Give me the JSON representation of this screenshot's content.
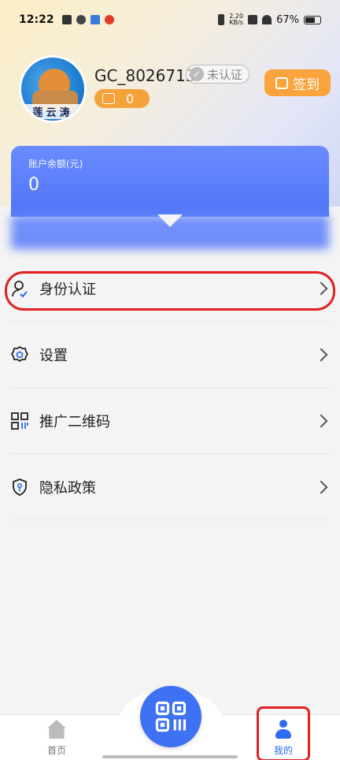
{
  "status_bar": {
    "time": "12:22",
    "net_speed": "2.20\nKB/s",
    "battery_percent": "67%"
  },
  "profile": {
    "username": "GC_8026713",
    "verify_status": "未认证",
    "coin_count": "0",
    "checkin_label": "签到",
    "avatar_text": "莲云涛"
  },
  "balance": {
    "label": "账户余额(元)",
    "value": "0"
  },
  "menu": {
    "items": [
      {
        "label": "身份认证",
        "icon": "user-check-icon"
      },
      {
        "label": "设置",
        "icon": "gear-icon"
      },
      {
        "label": "推广二维码",
        "icon": "qr-code-icon"
      },
      {
        "label": "隐私政策",
        "icon": "shield-icon"
      }
    ]
  },
  "bottom_nav": {
    "home_label": "首页",
    "me_label": "我的"
  },
  "colors": {
    "accent": "#4f74f6",
    "checkin": "#f9a43c",
    "highlight": "#e02020"
  }
}
